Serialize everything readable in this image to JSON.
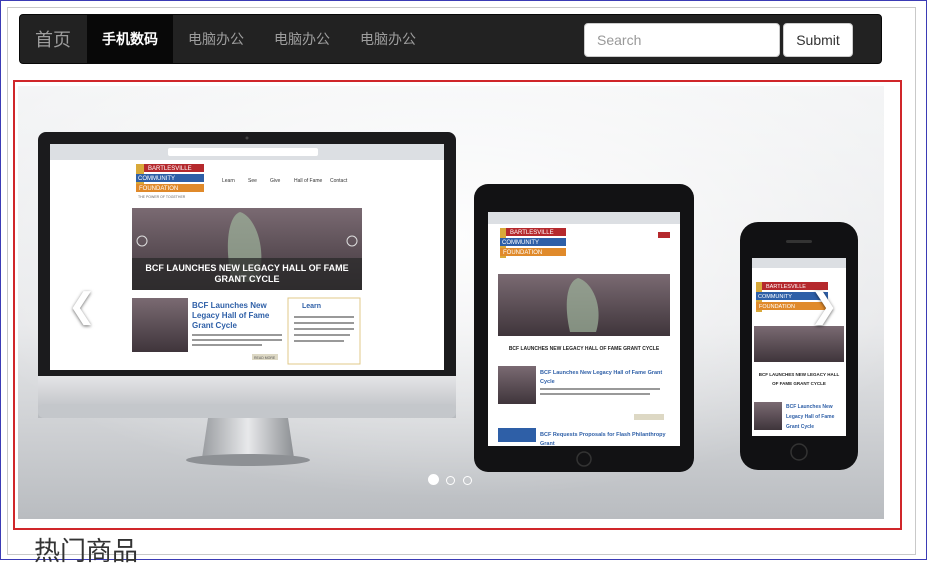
{
  "navbar": {
    "brand": "首页",
    "items": [
      {
        "label": "手机数码",
        "active": true
      },
      {
        "label": "电脑办公",
        "active": false
      },
      {
        "label": "电脑办公",
        "active": false
      },
      {
        "label": "电脑办公",
        "active": false
      }
    ],
    "search_placeholder": "Search",
    "submit_label": "Submit"
  },
  "carousel": {
    "slide_image": "responsive-devices-bcf-website",
    "active_index": 0,
    "indicator_count": 3,
    "prev_icon": "chevron-left-icon",
    "next_icon": "chevron-right-icon",
    "slide": {
      "org_line1": "BARTLESVILLE",
      "org_line2": "COMMUNITY",
      "org_line3": "FOUNDATION",
      "tagline": "THE POWER OF TOGETHER",
      "nav_learn": "Learn",
      "nav_see": "See",
      "nav_give": "Give",
      "nav_hall": "Hall of Fame",
      "nav_contact": "Contact",
      "headline": "BCF LAUNCHES NEW LEGACY HALL OF FAME",
      "headline2": "GRANT CYCLE",
      "article_title1": "BCF Launches New",
      "article_title2": "Legacy Hall of Fame",
      "article_title3": "Grant Cycle",
      "sidebar_title": "Learn",
      "read_more": "READ MORE",
      "tablet_headline": "BCF LAUNCHES NEW LEGACY HALL OF FAME GRANT CYCLE",
      "tablet_article1": "BCF Launches New Legacy Hall of Fame Grant",
      "tablet_article2": "Cycle",
      "tablet_article3": "BCF Requests Proposals for Flash Philanthropy",
      "tablet_article4": "Grant",
      "phone_headline1": "BCF LAUNCHES NEW LEGACY HALL",
      "phone_headline2": "OF FAME GRANT CYCLE",
      "phone_article1": "BCF Launches New",
      "phone_article2": "Legacy Hall of Fame",
      "phone_article3": "Grant Cycle"
    }
  },
  "section_heading_partial": "热门商品"
}
